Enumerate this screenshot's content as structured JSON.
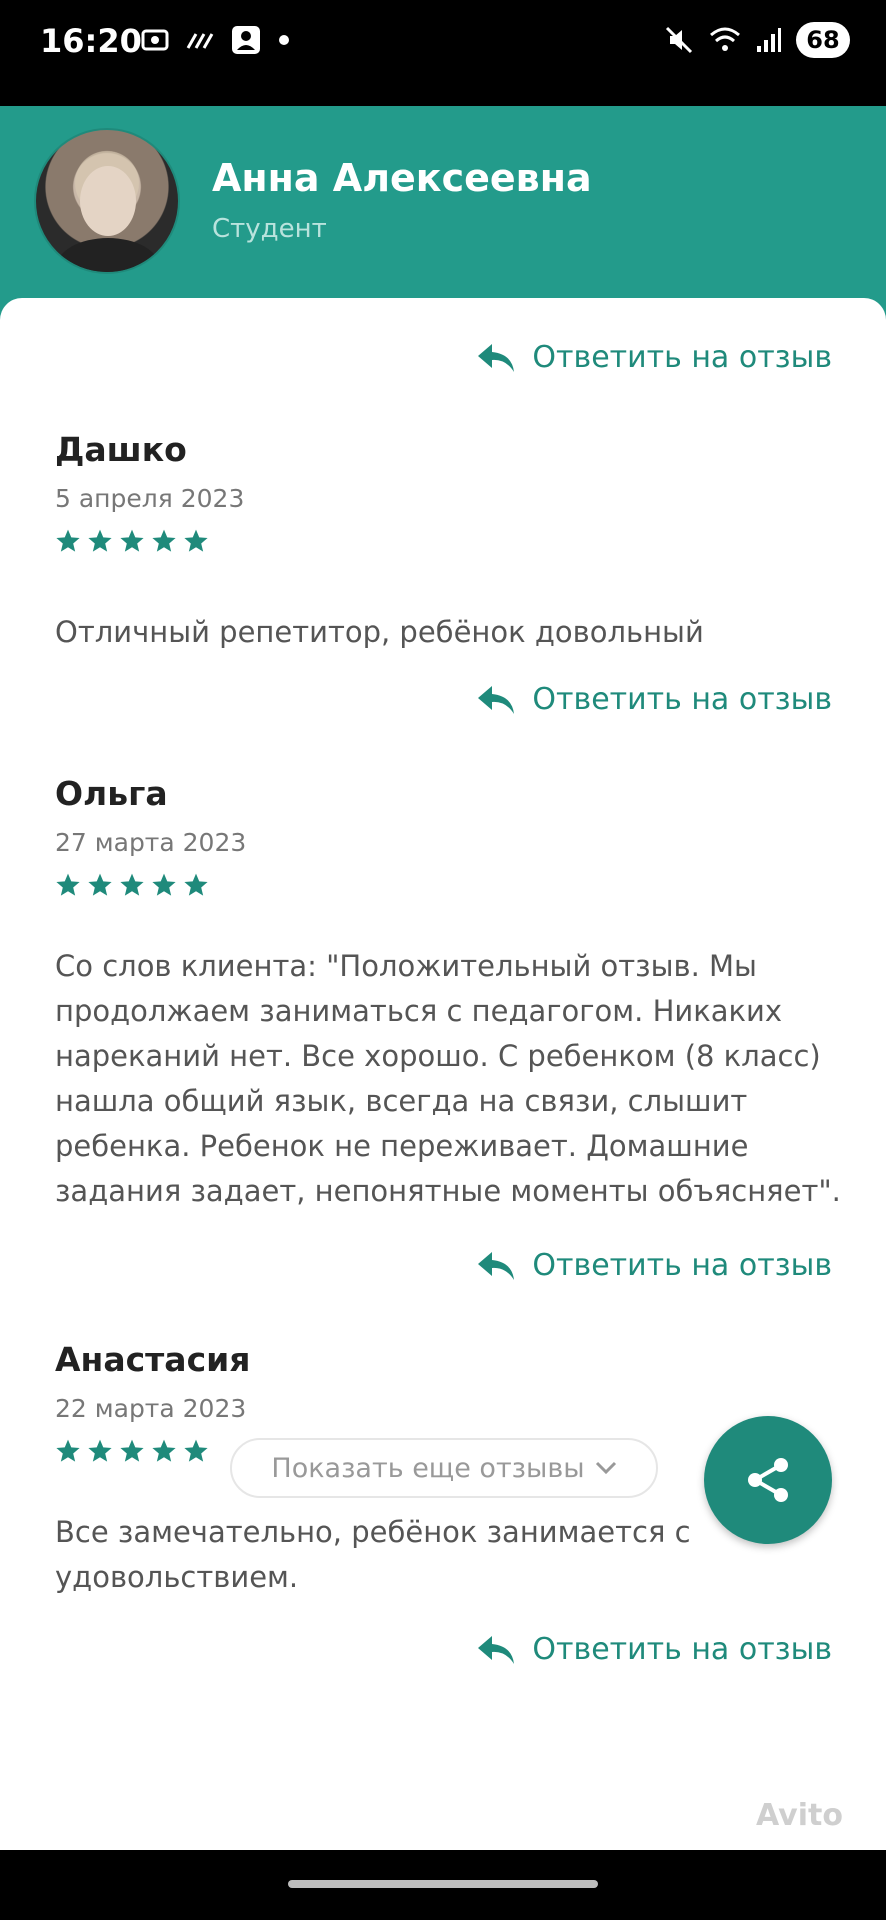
{
  "status_bar": {
    "time": "16:20",
    "battery": "68",
    "icons_left": [
      "screenshot-icon",
      "data-icon",
      "contact-card-icon",
      "dot-icon"
    ],
    "icons_right": [
      "mute-icon",
      "wifi-icon",
      "signal-icon"
    ]
  },
  "profile": {
    "name": "Анна Алексеевна",
    "role": "Студент"
  },
  "reply_label": "Ответить на отзыв",
  "reviews": [
    {
      "author": "Дашко",
      "date": "5 апреля 2023",
      "rating": 5,
      "text": "Отличный репетитор, ребёнок довольный",
      "reply": "Ответить на отзыв"
    },
    {
      "author": "Ольга",
      "date": "27 марта 2023",
      "rating": 5,
      "text": "Со слов клиента: \"Положительный отзыв. Мы продолжаем заниматься с педагогом. Никаких нареканий нет. Все хорошо. С ребенком (8 класс) нашла общий язык, всегда на связи, слышит ребенка. Ребенок не переживает. Домашние задания задает, непонятные моменты объясняет\".",
      "reply": "Ответить на отзыв"
    },
    {
      "author": "Анастасия",
      "date": "22 марта 2023",
      "rating": 5,
      "text": "Все замечательно, ребёнок занимается с удовольствием.",
      "reply": "Ответить на отзыв"
    }
  ],
  "show_more_label": "Показать еще отзывы",
  "watermark": "Avito",
  "colors": {
    "accent": "#239b8b",
    "accent_dark": "#1f8a7b",
    "text_dark": "#222222",
    "text_muted": "#777777"
  }
}
